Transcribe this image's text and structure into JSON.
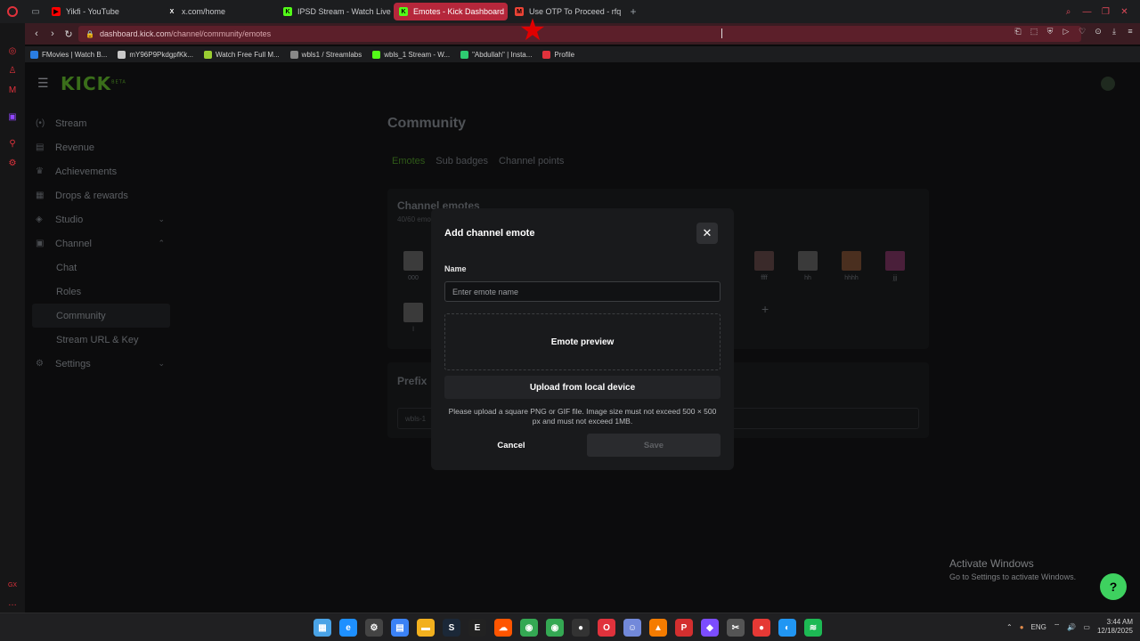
{
  "browser": {
    "tabs": [
      {
        "label": "Yikfi - YouTube",
        "fav_color": "#ff0000",
        "fav_text": "▶"
      },
      {
        "label": "x.com/home",
        "fav_color": "#1c1d1f",
        "fav_text": "X"
      },
      {
        "label": "IPSD Stream - Watch Live",
        "fav_color": "#53fc18",
        "fav_text": "K"
      },
      {
        "label": "Emotes - Kick Dashboard",
        "fav_color": "#53fc18",
        "fav_text": "K",
        "active": true
      },
      {
        "label": "Use OTP To Proceed - rfq",
        "fav_color": "#ea4335",
        "fav_text": "M"
      }
    ],
    "new_tab": "+",
    "url_host": "dashboard.kick.com",
    "url_path": "/channel/community/emotes",
    "bookmarks": [
      {
        "label": "FMovies | Watch B...",
        "color": "#2a7de1"
      },
      {
        "label": "mY96P9PkdgpfKk...",
        "color": "#c8c8c8"
      },
      {
        "label": "Watch Free Full M...",
        "color": "#9acd32"
      },
      {
        "label": "wbls1 / Streamlabs",
        "color": "#888888"
      },
      {
        "label": "wbls_1 Stream - W...",
        "color": "#53fc18"
      },
      {
        "label": "\"Abdullah\" | Insta...",
        "color": "#2ecc71"
      },
      {
        "label": "Profile",
        "color": "#e0323c"
      }
    ]
  },
  "app": {
    "logo": "KICK",
    "logo_tag": "BETA",
    "nav": [
      {
        "label": "Stream",
        "icon": "(•)",
        "name": "stream"
      },
      {
        "label": "Revenue",
        "icon": "▤",
        "name": "revenue"
      },
      {
        "label": "Achievements",
        "icon": "♛",
        "name": "achievements"
      },
      {
        "label": "Drops & rewards",
        "icon": "▦",
        "name": "drops-rewards"
      },
      {
        "label": "Studio",
        "icon": "◈",
        "name": "studio",
        "chev": "⌄"
      },
      {
        "label": "Channel",
        "icon": "▣",
        "name": "channel",
        "chev": "⌃"
      },
      {
        "label": "Chat",
        "sub": true,
        "name": "chat"
      },
      {
        "label": "Roles",
        "sub": true,
        "name": "roles"
      },
      {
        "label": "Community",
        "sub": true,
        "selected": true,
        "name": "community"
      },
      {
        "label": "Stream URL & Key",
        "sub": true,
        "name": "stream-url-key"
      },
      {
        "label": "Settings",
        "icon": "⚙",
        "name": "settings",
        "chev": "⌄"
      }
    ],
    "page_title": "Community",
    "tabs": [
      "Emotes",
      "Sub badges",
      "Channel points"
    ],
    "channel_emotes_title": "Channel emotes",
    "channel_emotes_count": "40/60 emotes",
    "emotes_row1": [
      {
        "label": "000",
        "color": "#3b3b3b"
      },
      {
        "label": "ffff",
        "color": "#3a2a2a"
      },
      {
        "label": "hh",
        "color": "#3a3a3a"
      },
      {
        "label": "hhhh",
        "color": "#4a2f1f"
      },
      {
        "label": "jjj",
        "color": "#4a1f3a"
      }
    ],
    "emotes_row2": [
      {
        "label": "l",
        "color": "#3a3a3a"
      }
    ],
    "add_emote_plus": "+",
    "prefix_title": "Prefix",
    "prefix_value": "wbls-1"
  },
  "modal": {
    "title": "Add channel emote",
    "close": "✕",
    "name_label": "Name",
    "name_placeholder": "Enter emote name",
    "name_value": "",
    "preview_label": "Emote preview",
    "upload_label": "Upload from local device",
    "hint": "Please upload a square PNG or GIF file. Image size must not exceed 500 × 500 px and must not exceed 1MB.",
    "cancel_label": "Cancel",
    "save_label": "Save"
  },
  "windows": {
    "activate_title": "Activate Windows",
    "activate_sub": "Go to Settings to activate Windows.",
    "time": "3:44 AM",
    "date": "12/18/2025",
    "lang": "ENG"
  }
}
